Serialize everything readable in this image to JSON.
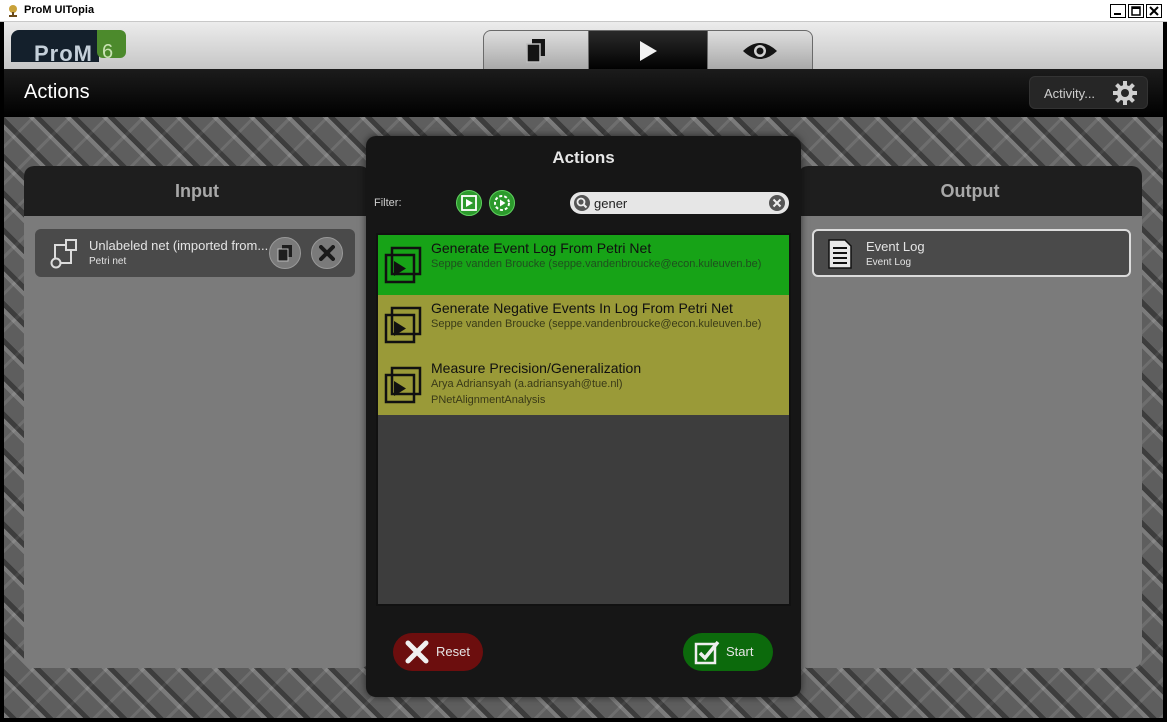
{
  "window": {
    "title": "ProM UITopia",
    "controls": [
      "minimize-icon",
      "maximize-icon",
      "close-icon"
    ]
  },
  "logo": {
    "name": "ProM",
    "version": "6"
  },
  "tabs": [
    {
      "icon": "workspace-icon",
      "active": false
    },
    {
      "icon": "play-icon",
      "active": true
    },
    {
      "icon": "eye-icon",
      "active": false
    }
  ],
  "header": {
    "title": "Actions",
    "activity_label": "Activity...",
    "activity_icon": "gear-icon"
  },
  "input_panel": {
    "title": "Input",
    "item": {
      "name": "Unlabeled net (imported from...",
      "type": "Petri net"
    }
  },
  "output_panel": {
    "title": "Output",
    "item": {
      "name": "Event Log",
      "type": "Event Log"
    }
  },
  "dialog": {
    "title": "Actions",
    "filter_label": "Filter:",
    "search_value": "gener",
    "actions": [
      {
        "title": "Generate Event Log From Petri Net",
        "author": "Seppe vanden Broucke (seppe.vandenbroucke@econ.kuleuven.be)",
        "package": "",
        "selected": true
      },
      {
        "title": "Generate Negative Events In Log From Petri Net",
        "author": "Seppe vanden Broucke (seppe.vandenbroucke@econ.kuleuven.be)",
        "package": "",
        "selected": false
      },
      {
        "title": "Measure Precision/Generalization",
        "author": "Arya Adriansyah (a.adriansyah@tue.nl)",
        "package": "PNetAlignmentAnalysis",
        "selected": false
      }
    ],
    "reset_label": "Reset",
    "start_label": "Start"
  },
  "colors": {
    "selected_row": "#17a317",
    "normal_row": "#9a9a38",
    "reset_button": "#6c0e0e",
    "start_button": "#0c6a0c"
  }
}
